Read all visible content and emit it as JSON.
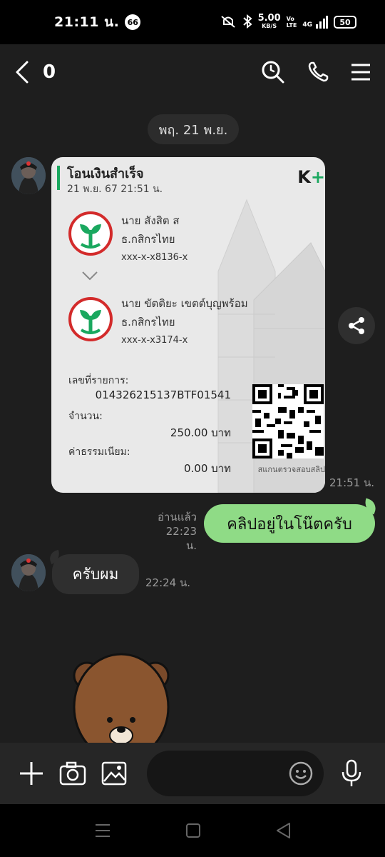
{
  "status_bar": {
    "time": "21:11 น.",
    "notification_count": "66",
    "net_speed": "5.00",
    "net_speed_unit": "KB/S",
    "volte_top": "Vo",
    "volte_bottom": "LTE",
    "network": "4G",
    "battery": "50"
  },
  "header": {
    "title": "0",
    "icons": [
      "back-icon",
      "search-icon",
      "phone-icon",
      "menu-icon"
    ]
  },
  "chat": {
    "date_chip": "พฤ. 21 พ.ย.",
    "slip": {
      "title": "โอนเงินสำเร็จ",
      "datetime": "21 พ.ย. 67  21:51 น.",
      "logo": "K",
      "logo_plus": "+",
      "sender_name": "นาย สังสิต ส",
      "sender_bank": "ธ.กสิกรไทย",
      "sender_account": "xxx-x-x8136-x",
      "receiver_name": "นาย ขัตติยะ เขตต์บุญพร้อม",
      "receiver_bank": "ธ.กสิกรไทย",
      "receiver_account": "xxx-x-x3174-x",
      "ref_label": "เลขที่รายการ:",
      "ref_value": "014326215137BTF01541",
      "amount_label": "จำนวน:",
      "amount_value": "250.00 บาท",
      "fee_label": "ค่าธรรมเนียม:",
      "fee_value": "0.00 บาท",
      "qr_caption": "สแกนตรวจสอบสลิป"
    },
    "slip_time": "21:51 น.",
    "outgoing": {
      "status": "อ่านแล้ว",
      "time": "22:23 น.",
      "text": "คลิปอยู่ในโน๊ตครับ"
    },
    "incoming": {
      "text": "ครับผม",
      "time": "22:24 น."
    }
  },
  "input_bar": {
    "placeholder": ""
  },
  "colors": {
    "chat_bg": "#1e1e1e",
    "outgoing_bubble": "#8fdb86",
    "incoming_bubble": "#2f2f2f",
    "kbank_green": "#1aa85f",
    "kbank_red": "#d32b2b"
  }
}
